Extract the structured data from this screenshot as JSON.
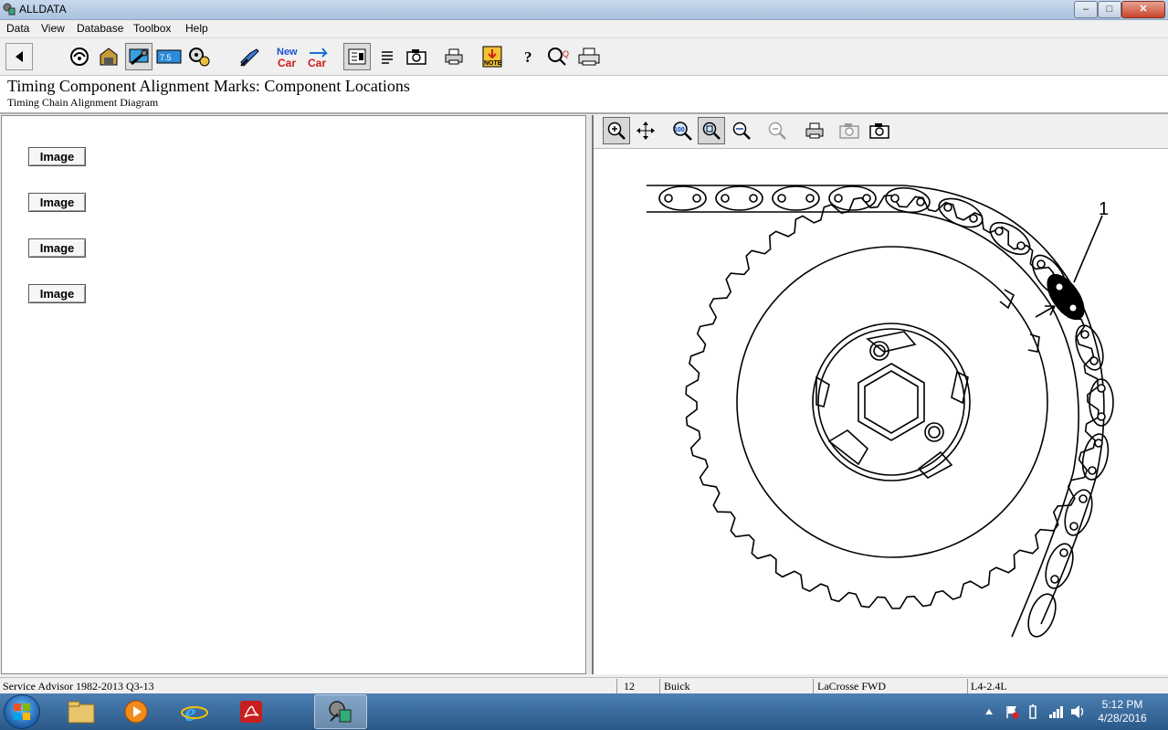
{
  "window": {
    "title": "ALLDATA",
    "minimize_label": "–",
    "maximize_label": "□",
    "close_label": "✕"
  },
  "menu": [
    "Data",
    "View",
    "Database",
    "Toolbox",
    "Help"
  ],
  "toolbar_icons": [
    "back-icon",
    "vehicle-icon",
    "garage-icon",
    "repair-info-icon",
    "labor-icon",
    "specs-icon",
    "diagnostic-icon",
    "new-car-icon",
    "change-car-icon",
    "text-view-icon",
    "list-view-icon",
    "camera-icon",
    "print-icon",
    "notes-icon",
    "help-icon",
    "search-icon",
    "printer-setup-icon"
  ],
  "header": {
    "title": "Timing Component Alignment Marks:  Component Locations",
    "subtitle": "Timing Chain Alignment Diagram"
  },
  "image_buttons": [
    "Image",
    "Image",
    "Image",
    "Image"
  ],
  "image_toolbar_icons": [
    "zoom-in-icon",
    "pan-icon",
    "zoom-100-icon",
    "zoom-fit-icon",
    "zoom-width-icon",
    "zoom-out-icon",
    "print-image-icon",
    "copy-image-icon",
    "save-image-icon"
  ],
  "diagram": {
    "callout": "1"
  },
  "status": {
    "product": "Service Advisor 1982-2013 Q3-13",
    "year": "12",
    "make": "Buick",
    "model": "LaCrosse FWD",
    "engine": "L4-2.4L"
  },
  "taskbar": {
    "apps": [
      "explorer-icon",
      "media-player-icon",
      "internet-explorer-icon",
      "acrobat-icon",
      "alldata-icon"
    ],
    "time": "5:12 PM",
    "date": "4/28/2016"
  },
  "colors": {
    "titlebar": "#b4c9e2",
    "taskbar": "#3b6da0"
  }
}
